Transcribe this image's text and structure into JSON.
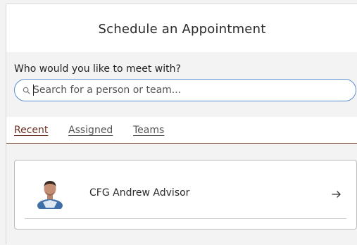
{
  "header": {
    "title": "Schedule an Appointment"
  },
  "search": {
    "prompt": "Who would you like to meet with?",
    "placeholder": "Search for a person or team...",
    "value": "",
    "icon": "search-icon"
  },
  "tabs": [
    {
      "label": "Recent",
      "active": true
    },
    {
      "label": "Assigned",
      "active": false
    },
    {
      "label": "Teams",
      "active": false
    }
  ],
  "results": [
    {
      "name": "CFG Andrew Advisor",
      "avatar": "person-photo",
      "action_icon": "arrow-right-icon"
    }
  ],
  "colors": {
    "accent_tab": "#6b2f21",
    "search_border": "#5b8fd6",
    "background": "#f3f3f3"
  }
}
